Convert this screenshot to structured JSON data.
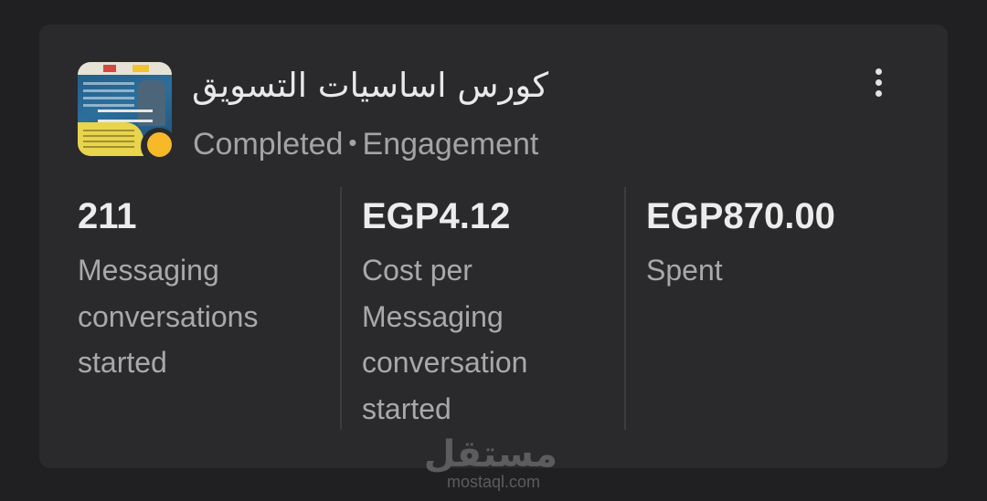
{
  "campaign": {
    "title": "كورس اساسيات التسويق",
    "status": "Completed",
    "separator": "•",
    "objective": "Engagement",
    "status_color": "#f7b928"
  },
  "menu": {
    "icon": "more-vertical-icon"
  },
  "metrics": [
    {
      "value": "211",
      "label": "Messaging conversations started"
    },
    {
      "value": "EGP4.12",
      "label": "Cost per Messaging conversation started"
    },
    {
      "value": "EGP870.00",
      "label": "Spent"
    }
  ],
  "watermark": {
    "arabic": "مستقل",
    "domain": "mostaql.com"
  }
}
